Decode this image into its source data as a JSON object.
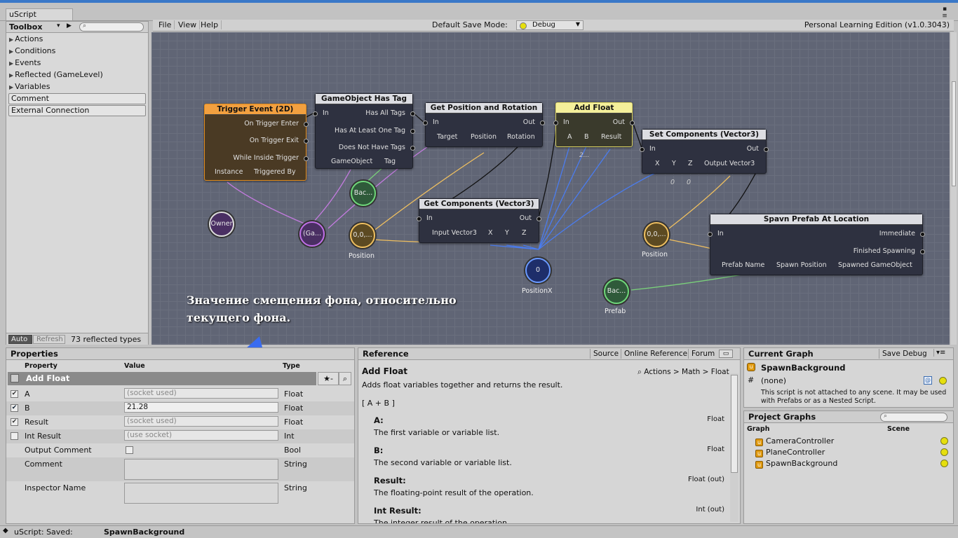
{
  "window": {
    "tab_title": "uScript"
  },
  "toolbox": {
    "title": "Toolbox",
    "tree": [
      "Actions",
      "Conditions",
      "Events",
      "Reflected (GameLevel)",
      "Variables"
    ],
    "buttons": [
      "Comment",
      "External Connection"
    ],
    "footer": {
      "auto": "Auto",
      "refresh": "Refresh",
      "count": "73 reflected types"
    }
  },
  "canvas_bar": {
    "menus": [
      "File",
      "View",
      "Help"
    ],
    "save_mode_label": "Default Save Mode:",
    "save_mode_value": "Debug",
    "edition": "Personal Learning Edition (v1.0.3043)"
  },
  "nodes": {
    "trigger": {
      "title": "Trigger Event (2D)",
      "outs": [
        "On Trigger Enter",
        "On Trigger Exit",
        "While Inside Trigger"
      ],
      "bottom": [
        "Instance",
        "Triggered By"
      ]
    },
    "hastag": {
      "title": "GameObject Has Tag",
      "in": "In",
      "outs": [
        "Has All Tags",
        "Has At Least One Tag",
        "Does Not Have Tags"
      ],
      "bottom": [
        "GameObject",
        "Tag"
      ]
    },
    "getpos": {
      "title": "Get Position and Rotation",
      "in": "In",
      "out": "Out",
      "bottom": [
        "Target",
        "Position",
        "Rotation"
      ]
    },
    "addfloat": {
      "title": "Add Float",
      "in": "In",
      "out": "Out",
      "bottom": [
        "A",
        "B",
        "Result"
      ],
      "note": "2..."
    },
    "setcomp": {
      "title": "Set Components (Vector3)",
      "in": "In",
      "out": "Out",
      "bottom": [
        "X",
        "Y",
        "Z",
        "Output Vector3"
      ],
      "sub": [
        "0",
        "0"
      ]
    },
    "getcomp": {
      "title": "Get Components (Vector3)",
      "in": "In",
      "out": "Out",
      "bottom": [
        "Input Vector3",
        "X",
        "Y",
        "Z"
      ]
    },
    "spawn": {
      "title": "Spavn Prefab At Location",
      "in": "In",
      "outs": [
        "Immediate",
        "Finished Spawning"
      ],
      "bottom": [
        "Prefab Name",
        "Spawn Position",
        "Spawned GameObject"
      ]
    }
  },
  "variables": {
    "owner": "Owner",
    "gameobj": "(Ga...",
    "back1": "Bac...",
    "pos1": "0,0,...",
    "pos1_cap": "Position",
    "posx": "0",
    "posx_cap": "PositionX",
    "pos2": "0,0,...",
    "pos2_cap": "Position",
    "back2": "Bac...",
    "back2_cap": "Prefab"
  },
  "annotation": {
    "line1": "Значение смещения фона, относительно",
    "line2": "текущего фона."
  },
  "properties": {
    "title": "Properties",
    "cols": [
      "Property",
      "Value",
      "Type"
    ],
    "group": "Add Float",
    "rows": [
      {
        "name": "A",
        "value": "(socket used)",
        "type": "Float",
        "checked": "✔"
      },
      {
        "name": "B",
        "value": "21.28",
        "type": "Float",
        "checked": "✔"
      },
      {
        "name": "Result",
        "value": "(socket used)",
        "type": "Float",
        "checked": "✔"
      },
      {
        "name": "Int Result",
        "value": "(use socket)",
        "type": "Int",
        "checked": ""
      }
    ],
    "output_comment": {
      "name": "Output Comment",
      "type": "Bool"
    },
    "comment": {
      "name": "Comment",
      "type": "String"
    },
    "inspector_name": {
      "name": "Inspector Name",
      "type": "String"
    }
  },
  "reference": {
    "title": "Reference",
    "tabs": [
      "Source",
      "Online Reference",
      "Forum"
    ],
    "node_name": "Add Float",
    "path": "Actions > Math > Float",
    "desc": "Adds float variables together and returns the result.",
    "formula": "[ A + B ]",
    "sections": [
      {
        "h": "A:",
        "t": "Float",
        "b": "The first variable or variable list."
      },
      {
        "h": "B:",
        "t": "Float",
        "b": "The second variable or variable list."
      },
      {
        "h": "Result:",
        "t": "Float (out)",
        "b": "The floating-point result of the operation."
      },
      {
        "h": "Int Result:",
        "t": "Int (out)",
        "b": "The integer result of the operation."
      }
    ]
  },
  "current_graph": {
    "title": "Current Graph",
    "save_btn": "Save Debug",
    "name": "SpawnBackground",
    "scene": "(none)",
    "note": "This script is not attached to any scene. It may be used with Prefabs or as a Nested Script."
  },
  "project_graphs": {
    "title": "Project Graphs",
    "cols": [
      "Graph",
      "Scene"
    ],
    "items": [
      "CameraController",
      "PlaneController",
      "SpawnBackground"
    ]
  },
  "status": {
    "label": "uScript: Saved:",
    "file": "SpawnBackground"
  }
}
